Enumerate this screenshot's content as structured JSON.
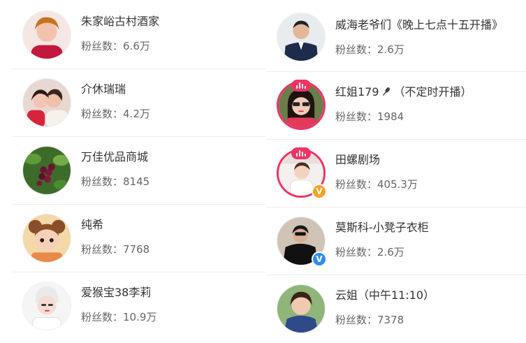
{
  "fans_label": "粉丝数：",
  "colors": {
    "live_ring": "#ee3366",
    "verify_orange": "#f7a023",
    "verify_blue": "#2d8cf0",
    "divider": "#ececec"
  },
  "left_column": [
    {
      "name": "朱家峪古村酒家",
      "fans": "6.6万"
    },
    {
      "name": "介休瑞瑞",
      "fans": "4.2万"
    },
    {
      "name": "万佳优品商城",
      "fans": "8145"
    },
    {
      "name": "纯希",
      "fans": "7768"
    },
    {
      "name": "爱猴宝38李莉",
      "fans": "10.9万"
    }
  ],
  "right_column": [
    {
      "name": "威海老爷们《晚上七点十五开播》",
      "fans": "2.6万"
    },
    {
      "name_before_icon": "红姐179",
      "name_after_icon": "（不定时开播）",
      "icon": "microphone-icon",
      "fans": "1984",
      "live": true
    },
    {
      "name": "田螺剧场",
      "fans": "405.3万",
      "live": true,
      "verified": "orange"
    },
    {
      "name": "莫斯科-小凳子衣柜",
      "fans": "2.6万",
      "verified": "blue"
    },
    {
      "name": "云姐（中午11:10）",
      "fans": "7378"
    }
  ]
}
